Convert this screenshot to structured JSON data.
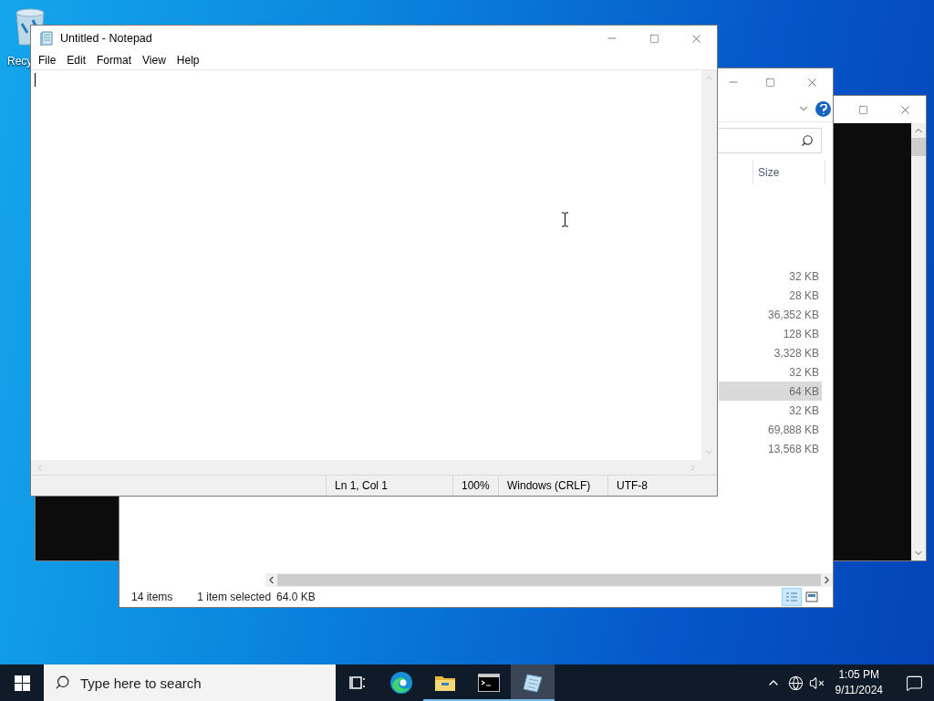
{
  "desktop": {
    "icons": [
      {
        "label": "Recy"
      }
    ]
  },
  "explorer": {
    "column_header": "Size",
    "rows": [
      {
        "size": "32 KB",
        "selected": false
      },
      {
        "size": "28 KB",
        "selected": false
      },
      {
        "size": "36,352 KB",
        "selected": false
      },
      {
        "size": "128 KB",
        "selected": false
      },
      {
        "size": "3,328 KB",
        "selected": false
      },
      {
        "size": "32 KB",
        "selected": false
      },
      {
        "size": "64 KB",
        "selected": true
      },
      {
        "size": "32 KB",
        "selected": false
      },
      {
        "size": "69,888 KB",
        "selected": false
      },
      {
        "size": "13,568 KB",
        "selected": false
      }
    ],
    "status": {
      "count": "14 items",
      "selection": "1 item selected",
      "selection_size": "64.0 KB"
    },
    "views": [
      {
        "kind": "details",
        "selected": true
      },
      {
        "kind": "thumbnails",
        "selected": false
      }
    ]
  },
  "notepad": {
    "title": "Untitled - Notepad",
    "menu": [
      "File",
      "Edit",
      "Format",
      "View",
      "Help"
    ],
    "status": [
      "Ln 1, Col 1",
      "100%",
      "Windows (CRLF)",
      "UTF-8"
    ]
  },
  "taskbar": {
    "search": {
      "placeholder": "Type here to search"
    },
    "apps": [
      {
        "kind": "task-view",
        "running": false,
        "selected": false
      },
      {
        "kind": "edge",
        "running": false,
        "selected": false
      },
      {
        "kind": "explorer",
        "running": true,
        "selected": false
      },
      {
        "kind": "terminal",
        "running": true,
        "selected": false
      },
      {
        "kind": "notepad",
        "running": true,
        "selected": true
      }
    ],
    "clock": {
      "time": "1:05 PM",
      "date": "9/11/2024"
    }
  }
}
